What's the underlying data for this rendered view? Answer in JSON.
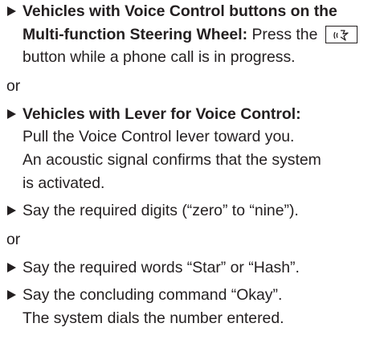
{
  "steps": [
    {
      "bold": "Vehicles with Voice Control buttons on the Multi-function Steering Wheel:",
      "text_before": " Press the ",
      "icon": "voice-control-button-icon",
      "text_after": " button while a phone call is in progress."
    },
    {
      "or": "or"
    },
    {
      "bold": "Vehicles with Lever for Voice Control:",
      "lines": [
        "Pull the Voice Control lever toward you.",
        "An acoustic signal confirms that the system",
        "is activated."
      ]
    },
    {
      "text": "Say the required digits (“zero” to “nine”)."
    },
    {
      "or": "or"
    },
    {
      "text": "Say the required words “Star” or “Hash”."
    },
    {
      "text": "Say the concluding command “Okay”.",
      "text2": "The system dials the number entered."
    }
  ]
}
